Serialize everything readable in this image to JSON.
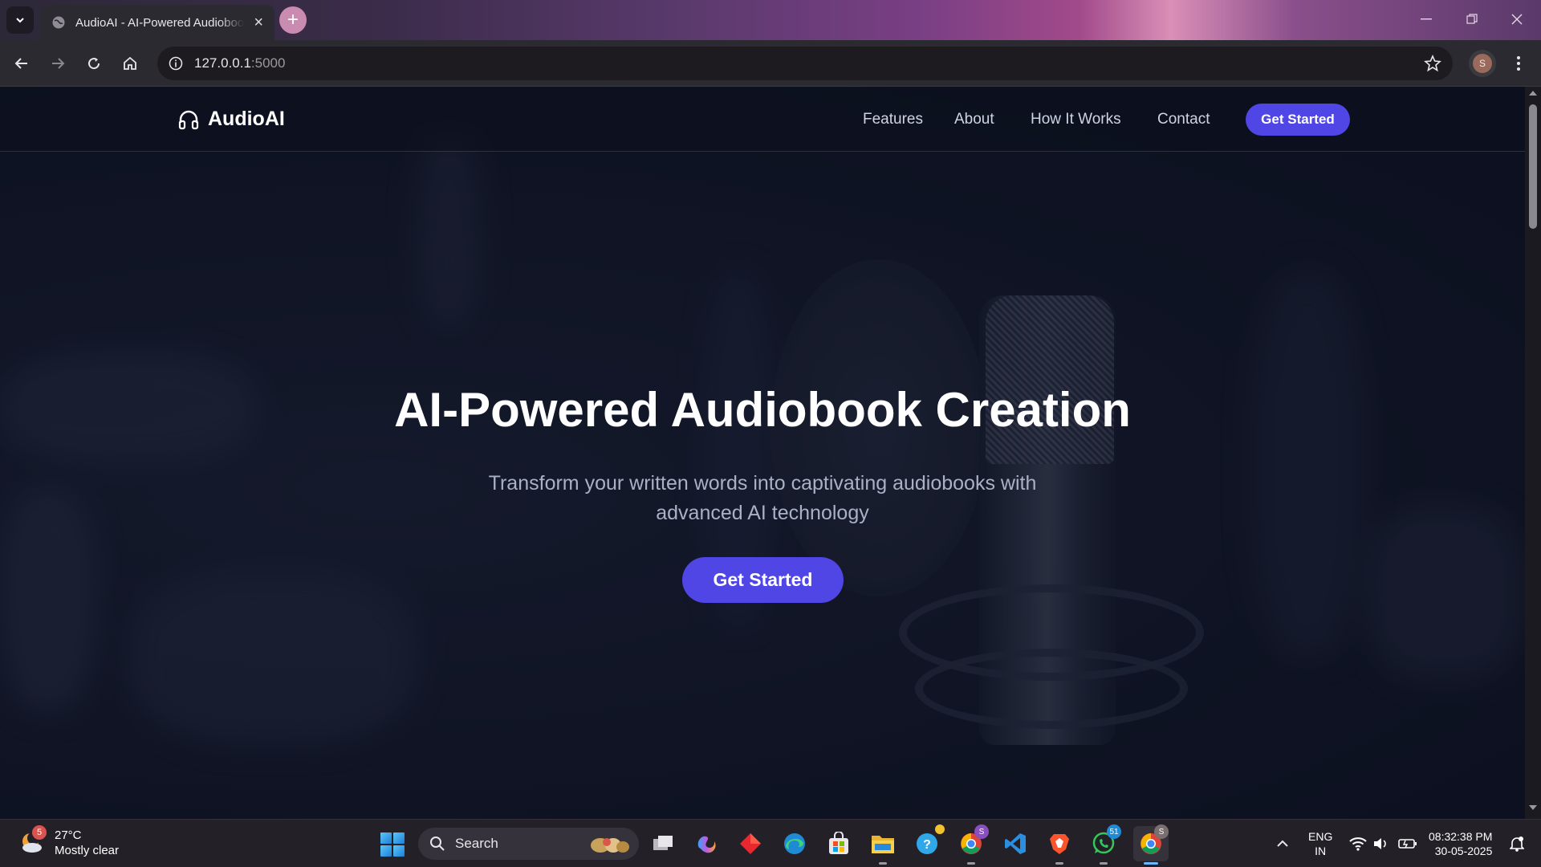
{
  "browser": {
    "tab_title": "AudioAI - AI-Powered Audiobook Creation",
    "url_host": "127.0.0.1",
    "url_port": ":5000",
    "profile_initial": "S"
  },
  "site": {
    "logo": "AudioAI",
    "nav": [
      "Features",
      "About",
      "How It Works",
      "Contact"
    ],
    "nav_cta": "Get Started",
    "hero_title": "AI-Powered Audiobook Creation",
    "hero_subtitle": "Transform your written words into captivating audiobooks with advanced AI technology",
    "hero_cta": "Get Started",
    "accent_color": "#4f46e5"
  },
  "taskbar": {
    "weather_temp": "27°C",
    "weather_desc": "Mostly clear",
    "weather_badge": "5",
    "search_label": "Search",
    "apps": [
      "task-view",
      "copilot",
      "red-app",
      "edge",
      "microsoft-store",
      "file-explorer",
      "quick-assist",
      "chrome-profile",
      "vscode",
      "brave",
      "whatsapp",
      "chrome"
    ],
    "badges": {
      "quick_assist": "",
      "chrome_profile": "S",
      "whatsapp": "51",
      "chrome": "S"
    },
    "lang_line1": "ENG",
    "lang_line2": "IN",
    "time": "08:32:38 PM",
    "date": "30-05-2025"
  }
}
